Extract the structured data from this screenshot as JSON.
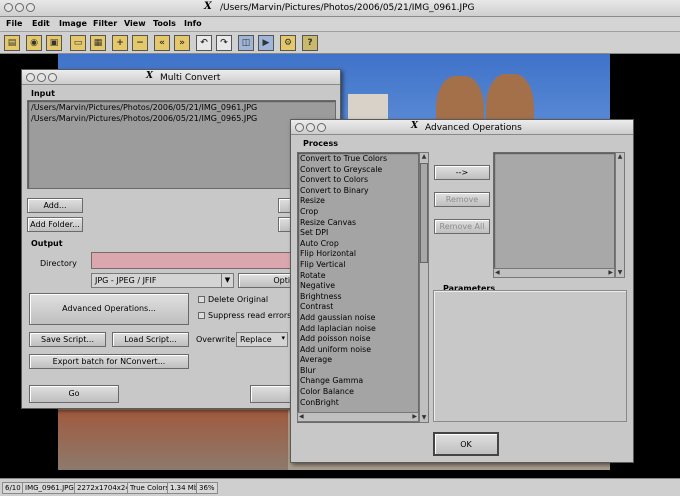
{
  "window": {
    "title": "/Users/Marvin/Pictures/Photos/2006/05/21/IMG_0961.JPG",
    "x_logo": "X"
  },
  "menu": [
    "File",
    "Edit",
    "Image",
    "Filter",
    "View",
    "Tools",
    "Info"
  ],
  "toolbar_icons": [
    "open-file-icon",
    "browse-icon",
    "save-icon",
    "print-icon",
    "thumbnail-icon",
    "zoom-in-icon",
    "zoom-out-icon",
    "previous-icon",
    "next-icon",
    "rotate-left-icon",
    "rotate-right-icon",
    "fullscreen-icon",
    "slideshow-icon",
    "settings-icon",
    "help-icon"
  ],
  "multi_convert": {
    "title": "Multi Convert",
    "input_label": "Input",
    "files": [
      "/Users/Marvin/Pictures/Photos/2006/05/21/IMG_0961.JPG",
      "/Users/Marvin/Pictures/Photos/2006/05/21/IMG_0965.JPG"
    ],
    "add": "Add...",
    "add_folder": "Add Folder...",
    "remove_partial": "R",
    "output_label": "Output",
    "directory_label": "Directory",
    "directory_value": "",
    "format": "JPG - JPEG / JFIF",
    "options_partial": "Optio",
    "advanced_ops": "Advanced Operations...",
    "delete_original": "Delete Original",
    "suppress_errors": "Suppress read errors",
    "save_script": "Save Script...",
    "load_script": "Load Script...",
    "overwrite_label": "Overwrite",
    "overwrite_value": "Replace",
    "export_batch": "Export batch for NConvert...",
    "go": "Go",
    "cancel_partial": "Ca"
  },
  "advanced": {
    "title": "Advanced Operations",
    "process_label": "Process",
    "processes": [
      "Convert to True Colors",
      "Convert to Greyscale",
      "Convert to Colors",
      "Convert to Binary",
      "Resize",
      "Crop",
      "Resize Canvas",
      "Set DPI",
      "Auto Crop",
      "Flip Horizontal",
      "Flip Vertical",
      "Rotate",
      "Negative",
      "Brightness",
      "Contrast",
      "Add gaussian noise",
      "Add laplacian noise",
      "Add poisson noise",
      "Add uniform noise",
      "Average",
      "Blur",
      "Change Gamma",
      "Color Balance",
      "ConBright"
    ],
    "add_arrow": "-->",
    "remove": "Remove",
    "remove_all": "Remove All",
    "parameters_label": "Parameters",
    "ok": "OK"
  },
  "status": {
    "index": "6/10",
    "file": "IMG_0961.JPG",
    "dims": "2272x1704x24",
    "colors": "True Colors",
    "size": "1.34 Mb",
    "zoom": "36%"
  },
  "colors": {
    "directory_field": "#d9a7ad",
    "desktop": "#000000"
  }
}
